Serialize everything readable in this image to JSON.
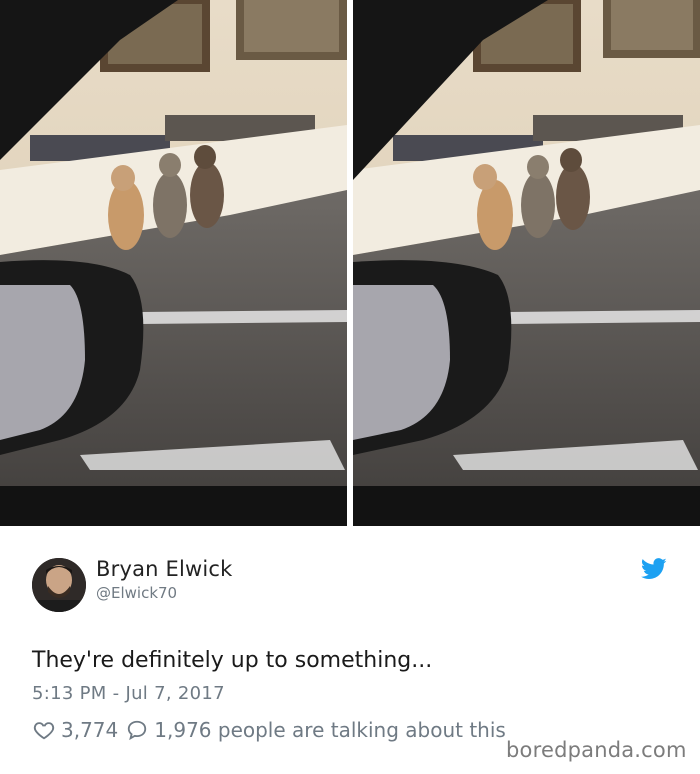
{
  "tweet": {
    "author_name": "Bryan Elwick",
    "author_handle": "@Elwick70",
    "text": "They're definitely up to something...",
    "timestamp": "5:13 PM - Jul 7, 2017",
    "likes": "3,774",
    "replies_summary": "1,976 people are talking about this"
  },
  "watermark": "boredpanda.com",
  "icons": {
    "brand": "twitter-bird-icon",
    "like": "heart-outline-icon",
    "reply": "speech-bubble-icon"
  },
  "colors": {
    "twitter_blue": "#1da1f2",
    "secondary_text": "#6f7a84"
  }
}
